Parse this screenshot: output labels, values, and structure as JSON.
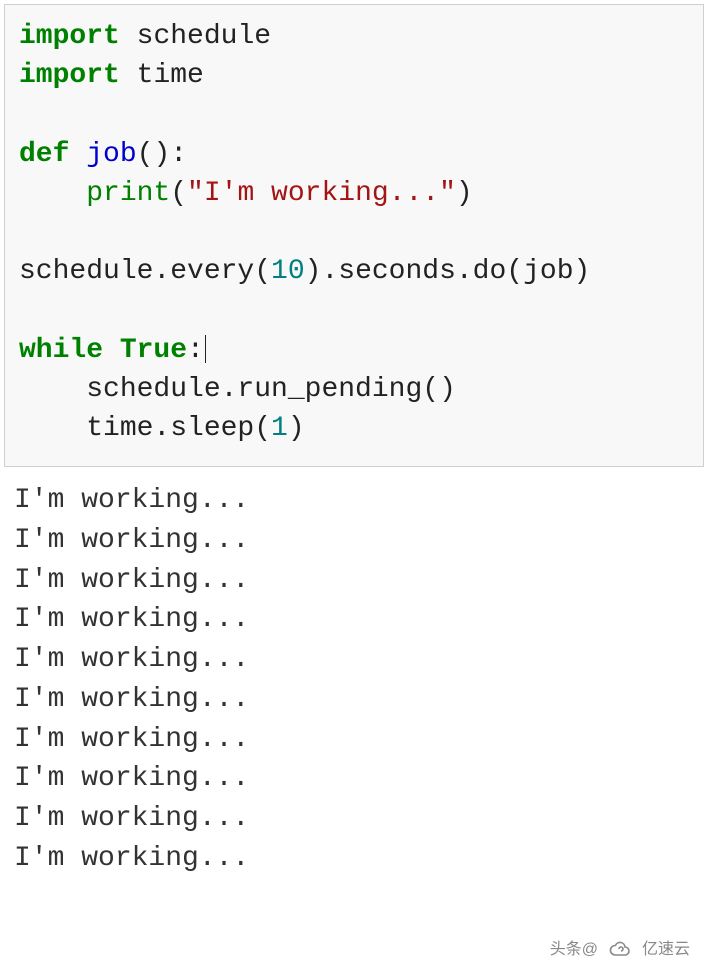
{
  "code": {
    "line1": {
      "kw": "import",
      "mod": "schedule"
    },
    "line2": {
      "kw": "import",
      "mod": "time"
    },
    "line4": {
      "kw": "def",
      "fn": "job",
      "tail": "():"
    },
    "line5": {
      "indent": "    ",
      "builtin": "print",
      "open": "(",
      "str": "\"I'm working...\"",
      "close": ")"
    },
    "line7": "schedule.every(",
    "line7_num": "10",
    "line7_tail": ").seconds.do(job)",
    "line9": {
      "kw": "while",
      "true": "True",
      "colon": ":"
    },
    "line10": "    schedule.run_pending()",
    "line11": {
      "indent": "    time.sleep(",
      "num": "1",
      "close": ")"
    }
  },
  "output_lines": [
    "I'm working...",
    "I'm working...",
    "I'm working...",
    "I'm working...",
    "I'm working...",
    "I'm working...",
    "I'm working...",
    "I'm working...",
    "I'm working...",
    "I'm working..."
  ],
  "watermark": {
    "text1": "头条@",
    "text2": "亿速云"
  }
}
